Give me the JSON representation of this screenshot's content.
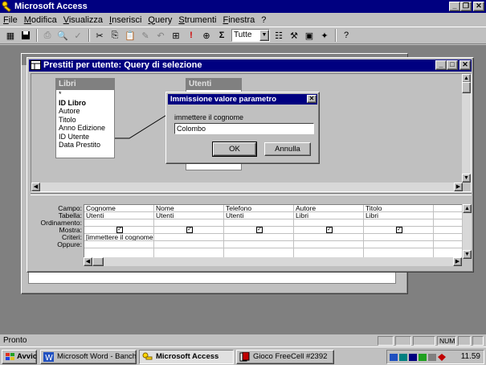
{
  "app": {
    "title": "Microsoft Access"
  },
  "menu": [
    "File",
    "Modifica",
    "Visualizza",
    "Inserisci",
    "Query",
    "Strumenti",
    "Finestra",
    "?"
  ],
  "toolbar": {
    "topvalues": "Tutte"
  },
  "query_window": {
    "title": "Prestiti per utente: Query di selezione"
  },
  "tables": {
    "libri": {
      "name": "Libri",
      "fields": [
        "*",
        "ID Libro",
        "Autore",
        "Titolo",
        "Anno Edizione",
        "ID Utente",
        "Data Prestito"
      ]
    },
    "utenti": {
      "name": "Utenti"
    }
  },
  "grid": {
    "row_labels": [
      "Campo:",
      "Tabella:",
      "Ordinamento:",
      "Mostra:",
      "Criteri:",
      "Oppure:"
    ],
    "columns": [
      {
        "field": "Cognome",
        "table": "Utenti",
        "show": true,
        "criteria": "[immettere il cognome]"
      },
      {
        "field": "Nome",
        "table": "Utenti",
        "show": true,
        "criteria": ""
      },
      {
        "field": "Telefono",
        "table": "Utenti",
        "show": true,
        "criteria": ""
      },
      {
        "field": "Autore",
        "table": "Libri",
        "show": true,
        "criteria": ""
      },
      {
        "field": "Titolo",
        "table": "Libri",
        "show": true,
        "criteria": ""
      }
    ]
  },
  "dialog": {
    "title": "Immissione valore parametro",
    "prompt": "immettere il cognome",
    "value": "Colombo",
    "ok": "OK",
    "cancel": "Annulla"
  },
  "status": {
    "text": "Pronto",
    "num": "NUM"
  },
  "taskbar": {
    "start": "Avvio",
    "tasks": [
      "Microsoft Word - Banche d...",
      "Microsoft Access",
      "Gioco FreeCell #2392"
    ],
    "clock": "11.59"
  }
}
